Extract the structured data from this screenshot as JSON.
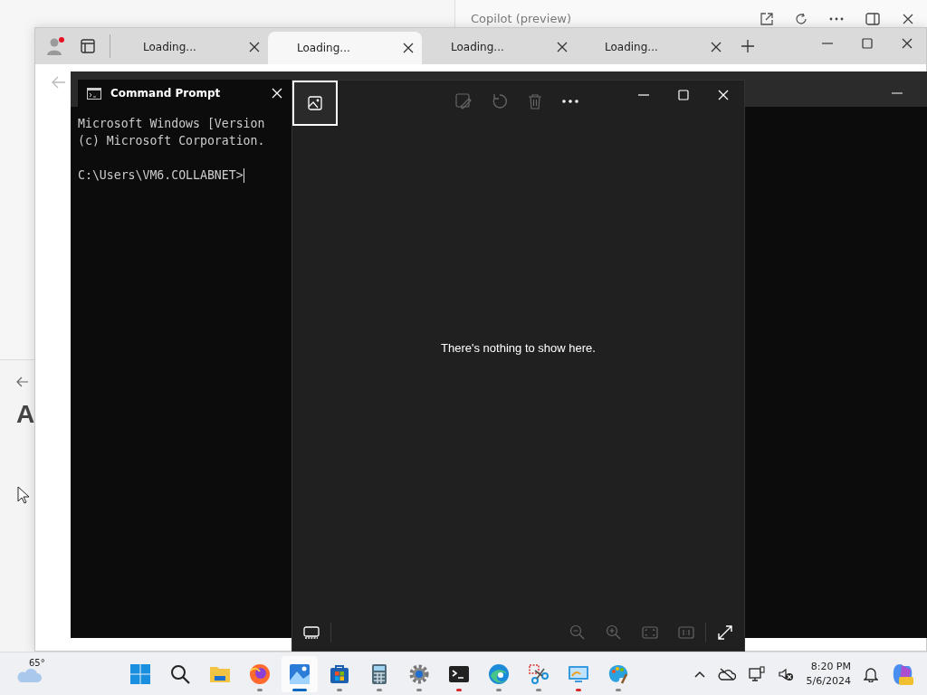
{
  "copilot_window": {
    "title": "Copilot (preview)"
  },
  "side_window": {
    "heading": "A"
  },
  "browser": {
    "tabs": [
      {
        "label": "Loading...",
        "selected": false
      },
      {
        "label": "Loading...",
        "selected": true
      },
      {
        "label": "Loading...",
        "selected": false
      },
      {
        "label": "Loading...",
        "selected": false
      }
    ]
  },
  "terminal": {
    "tab_title": "Command Prompt",
    "lines": [
      "Microsoft Windows [Version",
      "(c) Microsoft Corporation."
    ],
    "prompt": "C:\\Users\\VM6.COLLABNET>"
  },
  "photos": {
    "message": "There's nothing to show here."
  },
  "taskbar": {
    "weather": "65°",
    "apps": [
      {
        "kind": "start",
        "running": false,
        "selected": false,
        "attention": false
      },
      {
        "kind": "search",
        "running": false,
        "selected": false,
        "attention": false
      },
      {
        "kind": "explorer",
        "running": false,
        "selected": false,
        "attention": false
      },
      {
        "kind": "firefox",
        "running": true,
        "selected": false,
        "attention": false
      },
      {
        "kind": "photos",
        "running": true,
        "selected": true,
        "attention": false
      },
      {
        "kind": "store",
        "running": true,
        "selected": false,
        "attention": false
      },
      {
        "kind": "calculator",
        "running": true,
        "selected": false,
        "attention": false
      },
      {
        "kind": "settings",
        "running": true,
        "selected": false,
        "attention": false
      },
      {
        "kind": "terminal",
        "running": true,
        "selected": false,
        "attention": true
      },
      {
        "kind": "edge",
        "running": true,
        "selected": false,
        "attention": false
      },
      {
        "kind": "snipping",
        "running": true,
        "selected": false,
        "attention": false
      },
      {
        "kind": "remote",
        "running": true,
        "selected": false,
        "attention": true
      },
      {
        "kind": "paint",
        "running": true,
        "selected": false,
        "attention": false
      }
    ],
    "clock": {
      "time": "8:20 PM",
      "date": "5/6/2024"
    }
  }
}
